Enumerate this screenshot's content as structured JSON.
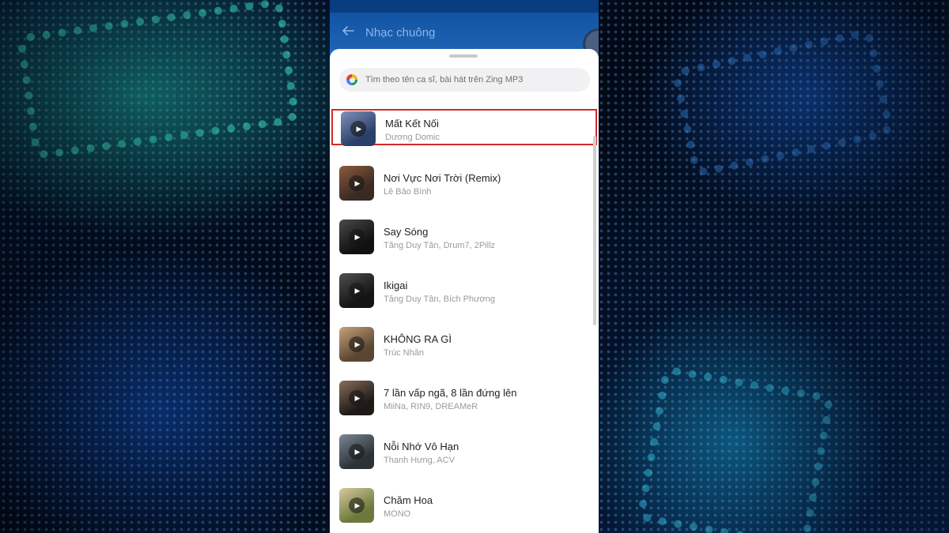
{
  "app": {
    "title": "Nhạc chuông"
  },
  "search": {
    "placeholder": "Tìm theo tên ca sĩ, bài hát trên Zing MP3"
  },
  "songs": [
    {
      "title": "Mất Kết Nối",
      "artist": "Dương Domic",
      "selected": true,
      "thumb_colors": [
        "#2b3f6b",
        "#7f93b8"
      ]
    },
    {
      "title": "Nơi Vực Nơi Trời (Remix)",
      "artist": "Lê Bảo Bình",
      "selected": false,
      "thumb_colors": [
        "#3a2a24",
        "#8b5a3c"
      ]
    },
    {
      "title": "Say Sóng",
      "artist": "Tăng Duy Tân, Drum7, 2Pillz",
      "selected": false,
      "thumb_colors": [
        "#111111",
        "#4a4a4a"
      ]
    },
    {
      "title": "Ikigai",
      "artist": "Tăng Duy Tân, Bích Phương",
      "selected": false,
      "thumb_colors": [
        "#141414",
        "#505050"
      ]
    },
    {
      "title": "KHÔNG RA GÌ",
      "artist": "Trúc Nhân",
      "selected": false,
      "thumb_colors": [
        "#5a4632",
        "#c7a27a"
      ]
    },
    {
      "title": "7 lần vấp ngã, 8 lần đứng lên",
      "artist": "MiiNa, RIN9, DREAMeR",
      "selected": false,
      "thumb_colors": [
        "#1e1a18",
        "#8a6e5c"
      ]
    },
    {
      "title": "Nỗi Nhớ Vô Hạn",
      "artist": "Thanh Hưng, ACV",
      "selected": false,
      "thumb_colors": [
        "#2d3238",
        "#7a8794"
      ]
    },
    {
      "title": "Chăm Hoa",
      "artist": "MONO",
      "selected": false,
      "thumb_colors": [
        "#6b7a3a",
        "#d8c9a0"
      ]
    }
  ],
  "colors": {
    "accent": "#1e62b3",
    "selection_border": "#d42a2a"
  },
  "icons": {
    "back": "arrow-left-icon",
    "search": "zing-mp3-logo-icon",
    "play": "play-icon"
  }
}
